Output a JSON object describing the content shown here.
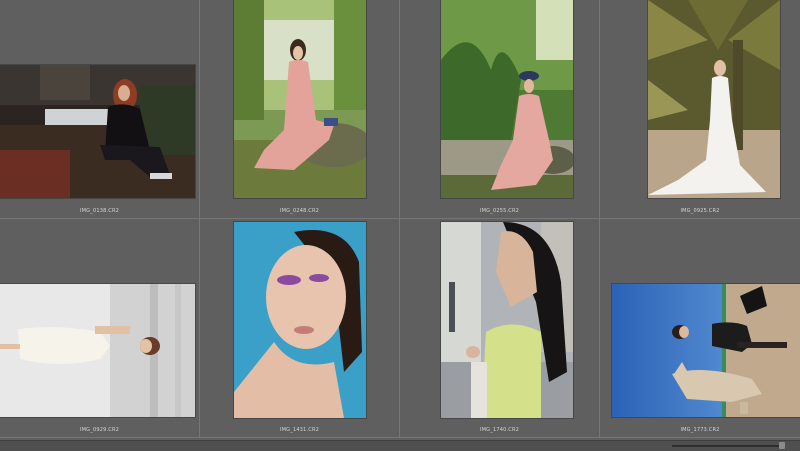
{
  "thumbnails": [
    {
      "filename": "IMG_0138.CR2",
      "subject": "woman in black sitting on rocks"
    },
    {
      "filename": "IMG_0248.CR2",
      "subject": "woman in pink dress sitting on stone"
    },
    {
      "filename": "IMG_0255.CR2",
      "subject": "woman in pink dress with hat by plants"
    },
    {
      "filename": "IMG_0925.CR2",
      "subject": "bride under palm trees"
    },
    {
      "filename": "IMG_0929.CR2",
      "subject": "woman in white dress lying, rotated"
    },
    {
      "filename": "IMG_1431.CR2",
      "subject": "beauty portrait on blue background"
    },
    {
      "filename": "IMG_1740.CR2",
      "subject": "woman with long dark hair in street"
    },
    {
      "filename": "IMG_1773.CR2",
      "subject": "woman with horse, rotated"
    }
  ],
  "colors": {
    "background": "#5f5f5f",
    "filename_text": "#d6d6d6",
    "grid_line": "#767676"
  }
}
